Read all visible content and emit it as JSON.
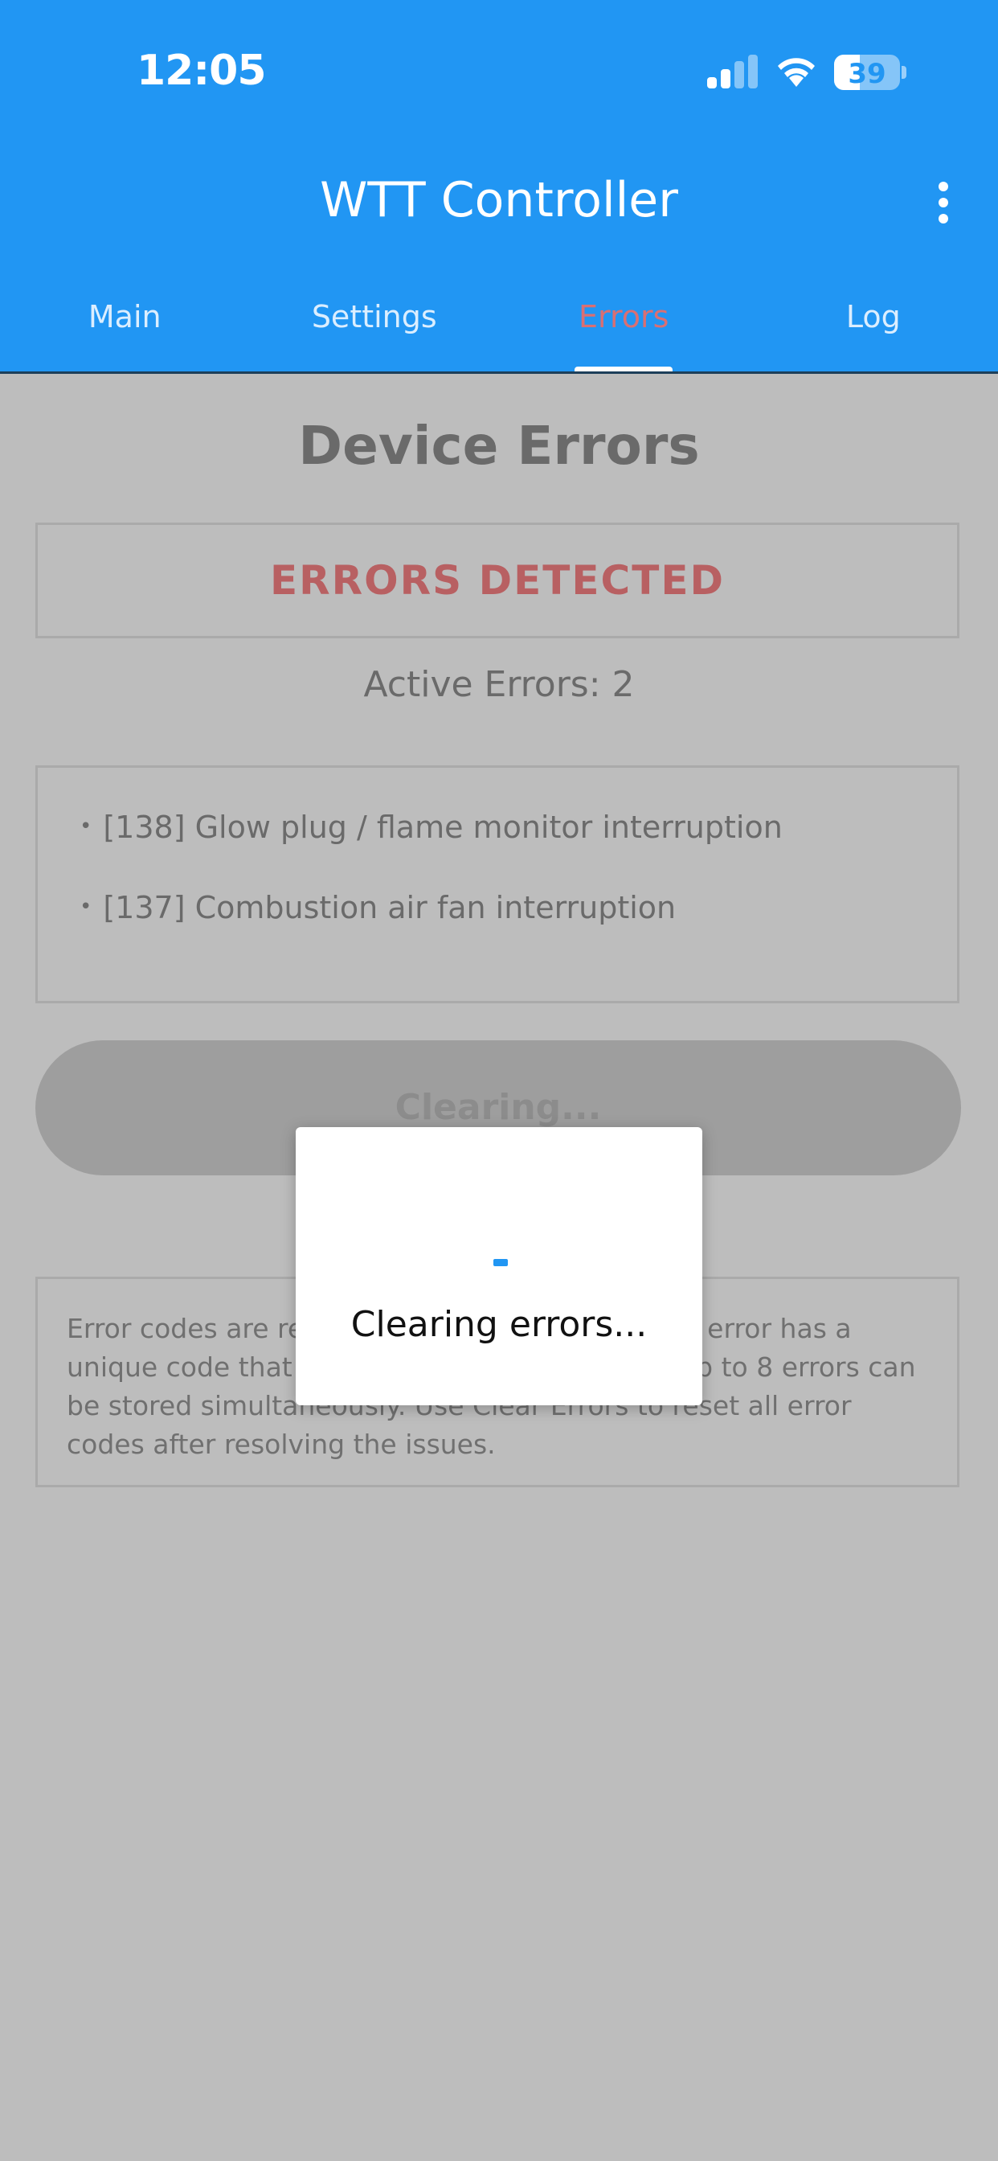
{
  "status_bar": {
    "time": "12:05",
    "battery": "39"
  },
  "app_bar": {
    "title": "WTT Controller",
    "menu_icon": "more-vertical-icon"
  },
  "tabs": [
    {
      "label": "Main"
    },
    {
      "label": "Settings"
    },
    {
      "label": "Errors",
      "active": true
    },
    {
      "label": "Log"
    }
  ],
  "page": {
    "title": "Device Errors",
    "status": "ERRORS DETECTED",
    "active_count": "Active Errors: 2",
    "errors": [
      {
        "text": "[138] Glow plug / flame monitor interruption"
      },
      {
        "text": "[137] Combustion air fan interruption"
      }
    ],
    "clear_button": "Clearing...",
    "info": "Error codes are read from the heater ECU. Each error has a unique code that identifies the specific issue. Up to 8 errors can be stored simultaneously. Use Clear Errors to reset all error codes after resolving the issues."
  },
  "dialog": {
    "message": "Clearing errors..."
  },
  "colors": {
    "primary": "#2196f3",
    "error": "#b86062",
    "active_tab": "#d96f73"
  }
}
